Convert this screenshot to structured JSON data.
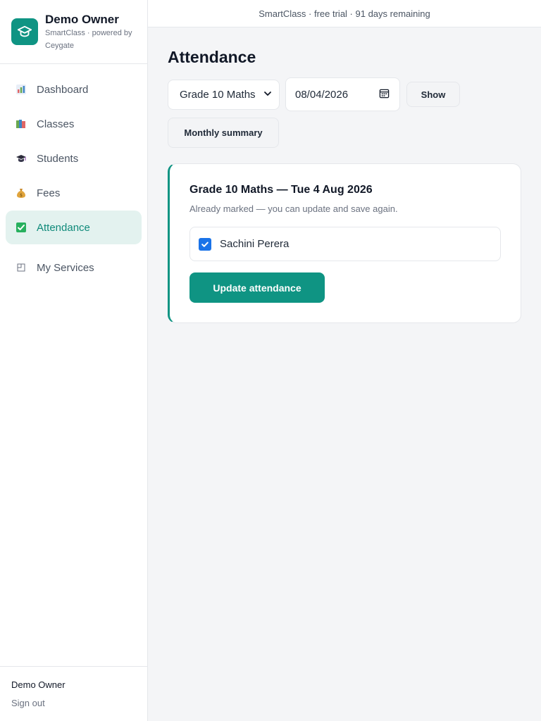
{
  "brand": {
    "name": "Demo Owner",
    "subtitle": "SmartClass · powered by Ceygate",
    "accent_color": "#0f9483"
  },
  "sidebar": {
    "items": [
      {
        "label": "Dashboard",
        "icon": "bar-chart-icon",
        "active": false
      },
      {
        "label": "Classes",
        "icon": "books-icon",
        "active": false
      },
      {
        "label": "Students",
        "icon": "graduation-cap-icon",
        "active": false
      },
      {
        "label": "Fees",
        "icon": "money-bag-icon",
        "active": false
      },
      {
        "label": "Attendance",
        "icon": "check-box-icon",
        "active": true
      },
      {
        "label": "My Services",
        "icon": "services-icon",
        "active": false
      }
    ],
    "footer": {
      "user_name": "Demo Owner",
      "sign_out_label": "Sign out"
    }
  },
  "topbar": {
    "status_text": "SmartClass · free trial · 91 days remaining"
  },
  "main": {
    "title": "Attendance",
    "class_select": {
      "value": "Grade 10 Maths"
    },
    "date_input": {
      "value": "08/04/2026"
    },
    "show_button_label": "Show",
    "monthly_summary_label": "Monthly summary",
    "card": {
      "title": "Grade 10 Maths — Tue 4 Aug 2026",
      "note": "Already marked — you can update and save again.",
      "students": [
        {
          "name": "Sachini Perera",
          "present": true
        }
      ],
      "update_button_label": "Update attendance"
    }
  }
}
